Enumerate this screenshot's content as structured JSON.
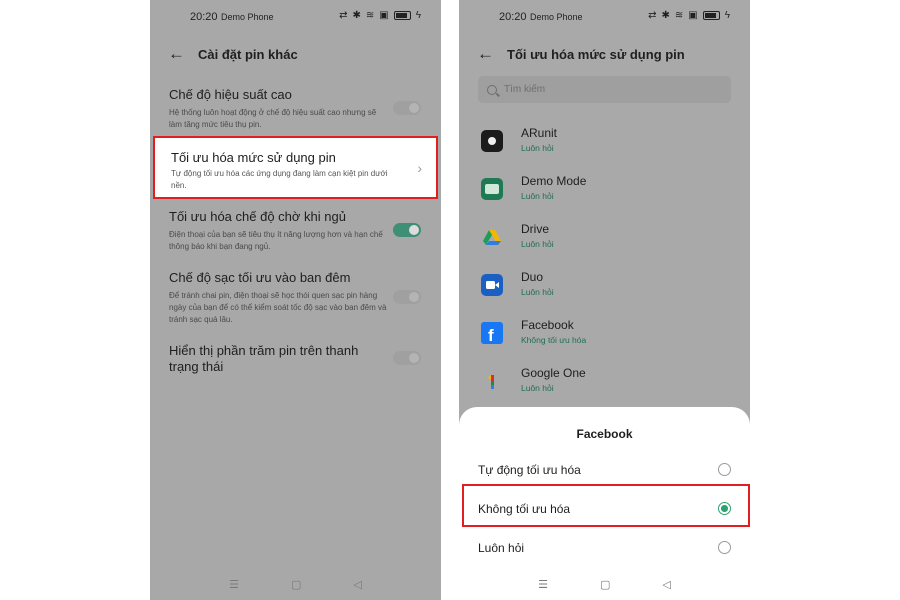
{
  "status_bar": {
    "time": "20:20",
    "carrier": "Demo Phone"
  },
  "left": {
    "title": "Cài đặt pin khác",
    "items": [
      {
        "title": "Chế độ hiệu suất cao",
        "desc": "Hệ thống luôn hoạt động ở chế độ hiệu suất cao nhưng sẽ làm tăng mức tiêu thụ pin.",
        "toggle": "off"
      },
      {
        "title": "Tối ưu hóa mức sử dụng pin",
        "desc": "Tự động tối ưu hóa các ứng dụng đang làm cạn kiệt pin dưới nền."
      },
      {
        "title": "Tối ưu hóa chế độ chờ khi ngủ",
        "desc": "Điện thoại của bạn sẽ tiêu thụ ít năng lượng hơn và hạn chế thông báo khi bạn đang ngủ.",
        "toggle": "on"
      },
      {
        "title": "Chế độ sạc tối ưu vào ban đêm",
        "desc": "Để tránh chai pin, điện thoại sẽ học thói quen sạc pin hàng ngày của bạn để có thể kiểm soát tốc độ sạc vào ban đêm và tránh sạc quá lâu.",
        "toggle": "off"
      },
      {
        "title": "Hiển thị phần trăm pin trên thanh trạng thái",
        "toggle": "off"
      }
    ]
  },
  "right": {
    "title": "Tối ưu hóa mức sử dụng pin",
    "search_placeholder": "Tìm kiếm",
    "apps": [
      {
        "name": "ARunit",
        "status": "Luôn hỏi",
        "icon": "arunit-icon",
        "color": "#1b1b1b"
      },
      {
        "name": "Demo Mode",
        "status": "Luôn hỏi",
        "icon": "demo-mode-icon",
        "color": "#1e7a52"
      },
      {
        "name": "Drive",
        "status": "Luôn hỏi",
        "icon": "drive-icon",
        "color": "#2f7de1"
      },
      {
        "name": "Duo",
        "status": "Luôn hỏi",
        "icon": "duo-icon",
        "color": "#1a5fc2"
      },
      {
        "name": "Facebook",
        "status": "Không tối ưu hóa",
        "icon": "facebook-icon",
        "color": "#1877f2"
      },
      {
        "name": "Google One",
        "status": "Luôn hỏi",
        "icon": "google-one-icon",
        "color": "#d93025"
      }
    ],
    "sheet": {
      "title": "Facebook",
      "options": [
        {
          "label": "Tự động tối ưu hóa",
          "selected": false
        },
        {
          "label": "Không tối ưu hóa",
          "selected": true
        },
        {
          "label": "Luôn hỏi",
          "selected": false
        }
      ]
    }
  },
  "colors": {
    "highlight": "#e02020",
    "accent_green": "#2fa06f",
    "toggle_on": "#3f8e76"
  }
}
